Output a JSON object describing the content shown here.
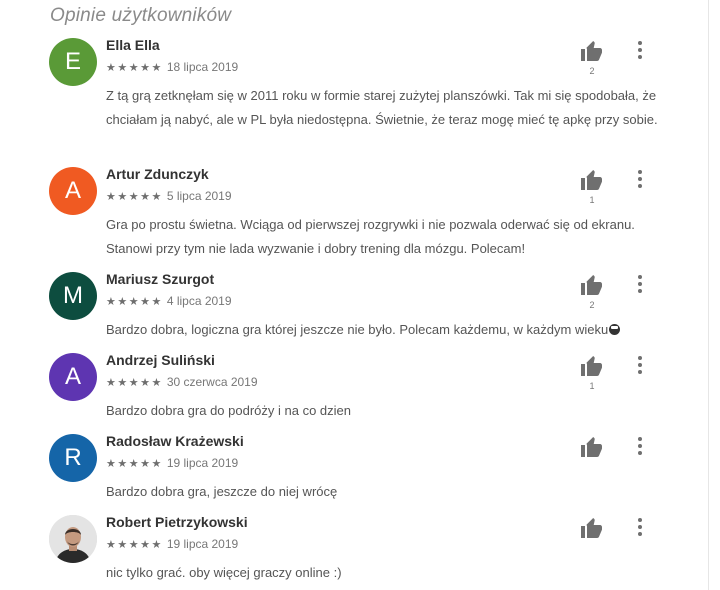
{
  "section_title": "Opinie użytkowników",
  "stars_glyph": "★★★★★",
  "reviews": [
    {
      "author": "Ella Ella",
      "initial": "E",
      "avatar_color": "#5a9a37",
      "date": "18 lipca 2019",
      "text": "Z tą grą zetknęłam się w 2011 roku w formie starej zużytej planszówki. Tak mi się spodobała, że chciałam ją nabyć, ale w PL była niedostępna. Świetnie, że teraz mogę mieć tę apkę przy sobie.",
      "helpful": "2"
    },
    {
      "author": "Artur Zdunczyk",
      "initial": "A",
      "avatar_color": "#f05a22",
      "date": "5 lipca 2019",
      "text": "Gra po prostu świetna. Wciąga od pierwszej rozgrywki i nie pozwala oderwać się od ekranu. Stanowi przy tym nie lada wyzwanie i dobry trening dla mózgu. Polecam!",
      "helpful": "1"
    },
    {
      "author": "Mariusz Szurgot",
      "initial": "M",
      "avatar_color": "#0d4d3f",
      "date": "4 lipca 2019",
      "text": "Bardzo dobra, logiczna gra której jeszcze nie było. Polecam każdemu, w każdym wieku",
      "helpful": "2"
    },
    {
      "author": "Andrzej Suliński",
      "initial": "A",
      "avatar_color": "#5e35b1",
      "date": "30 czerwca 2019",
      "text": "Bardzo dobra gra do podróży i na co dzien",
      "helpful": "1"
    },
    {
      "author": "Radosław Krażewski",
      "initial": "R",
      "avatar_color": "#1565a8",
      "date": "19 lipca 2019",
      "text": "Bardzo dobra gra, jeszcze do niej wrócę",
      "helpful": ""
    },
    {
      "author": "Robert Pietrzykowski",
      "initial": "",
      "avatar_color": "#d9d9d9",
      "date": "19 lipca 2019",
      "text": "nic tylko grać. oby więcej graczy online :)",
      "helpful": ""
    }
  ],
  "icons": {
    "thumb": "thumb-up-icon",
    "more": "more-vert-icon",
    "star": "star-icon",
    "emoji": "sunglasses-emoji"
  }
}
